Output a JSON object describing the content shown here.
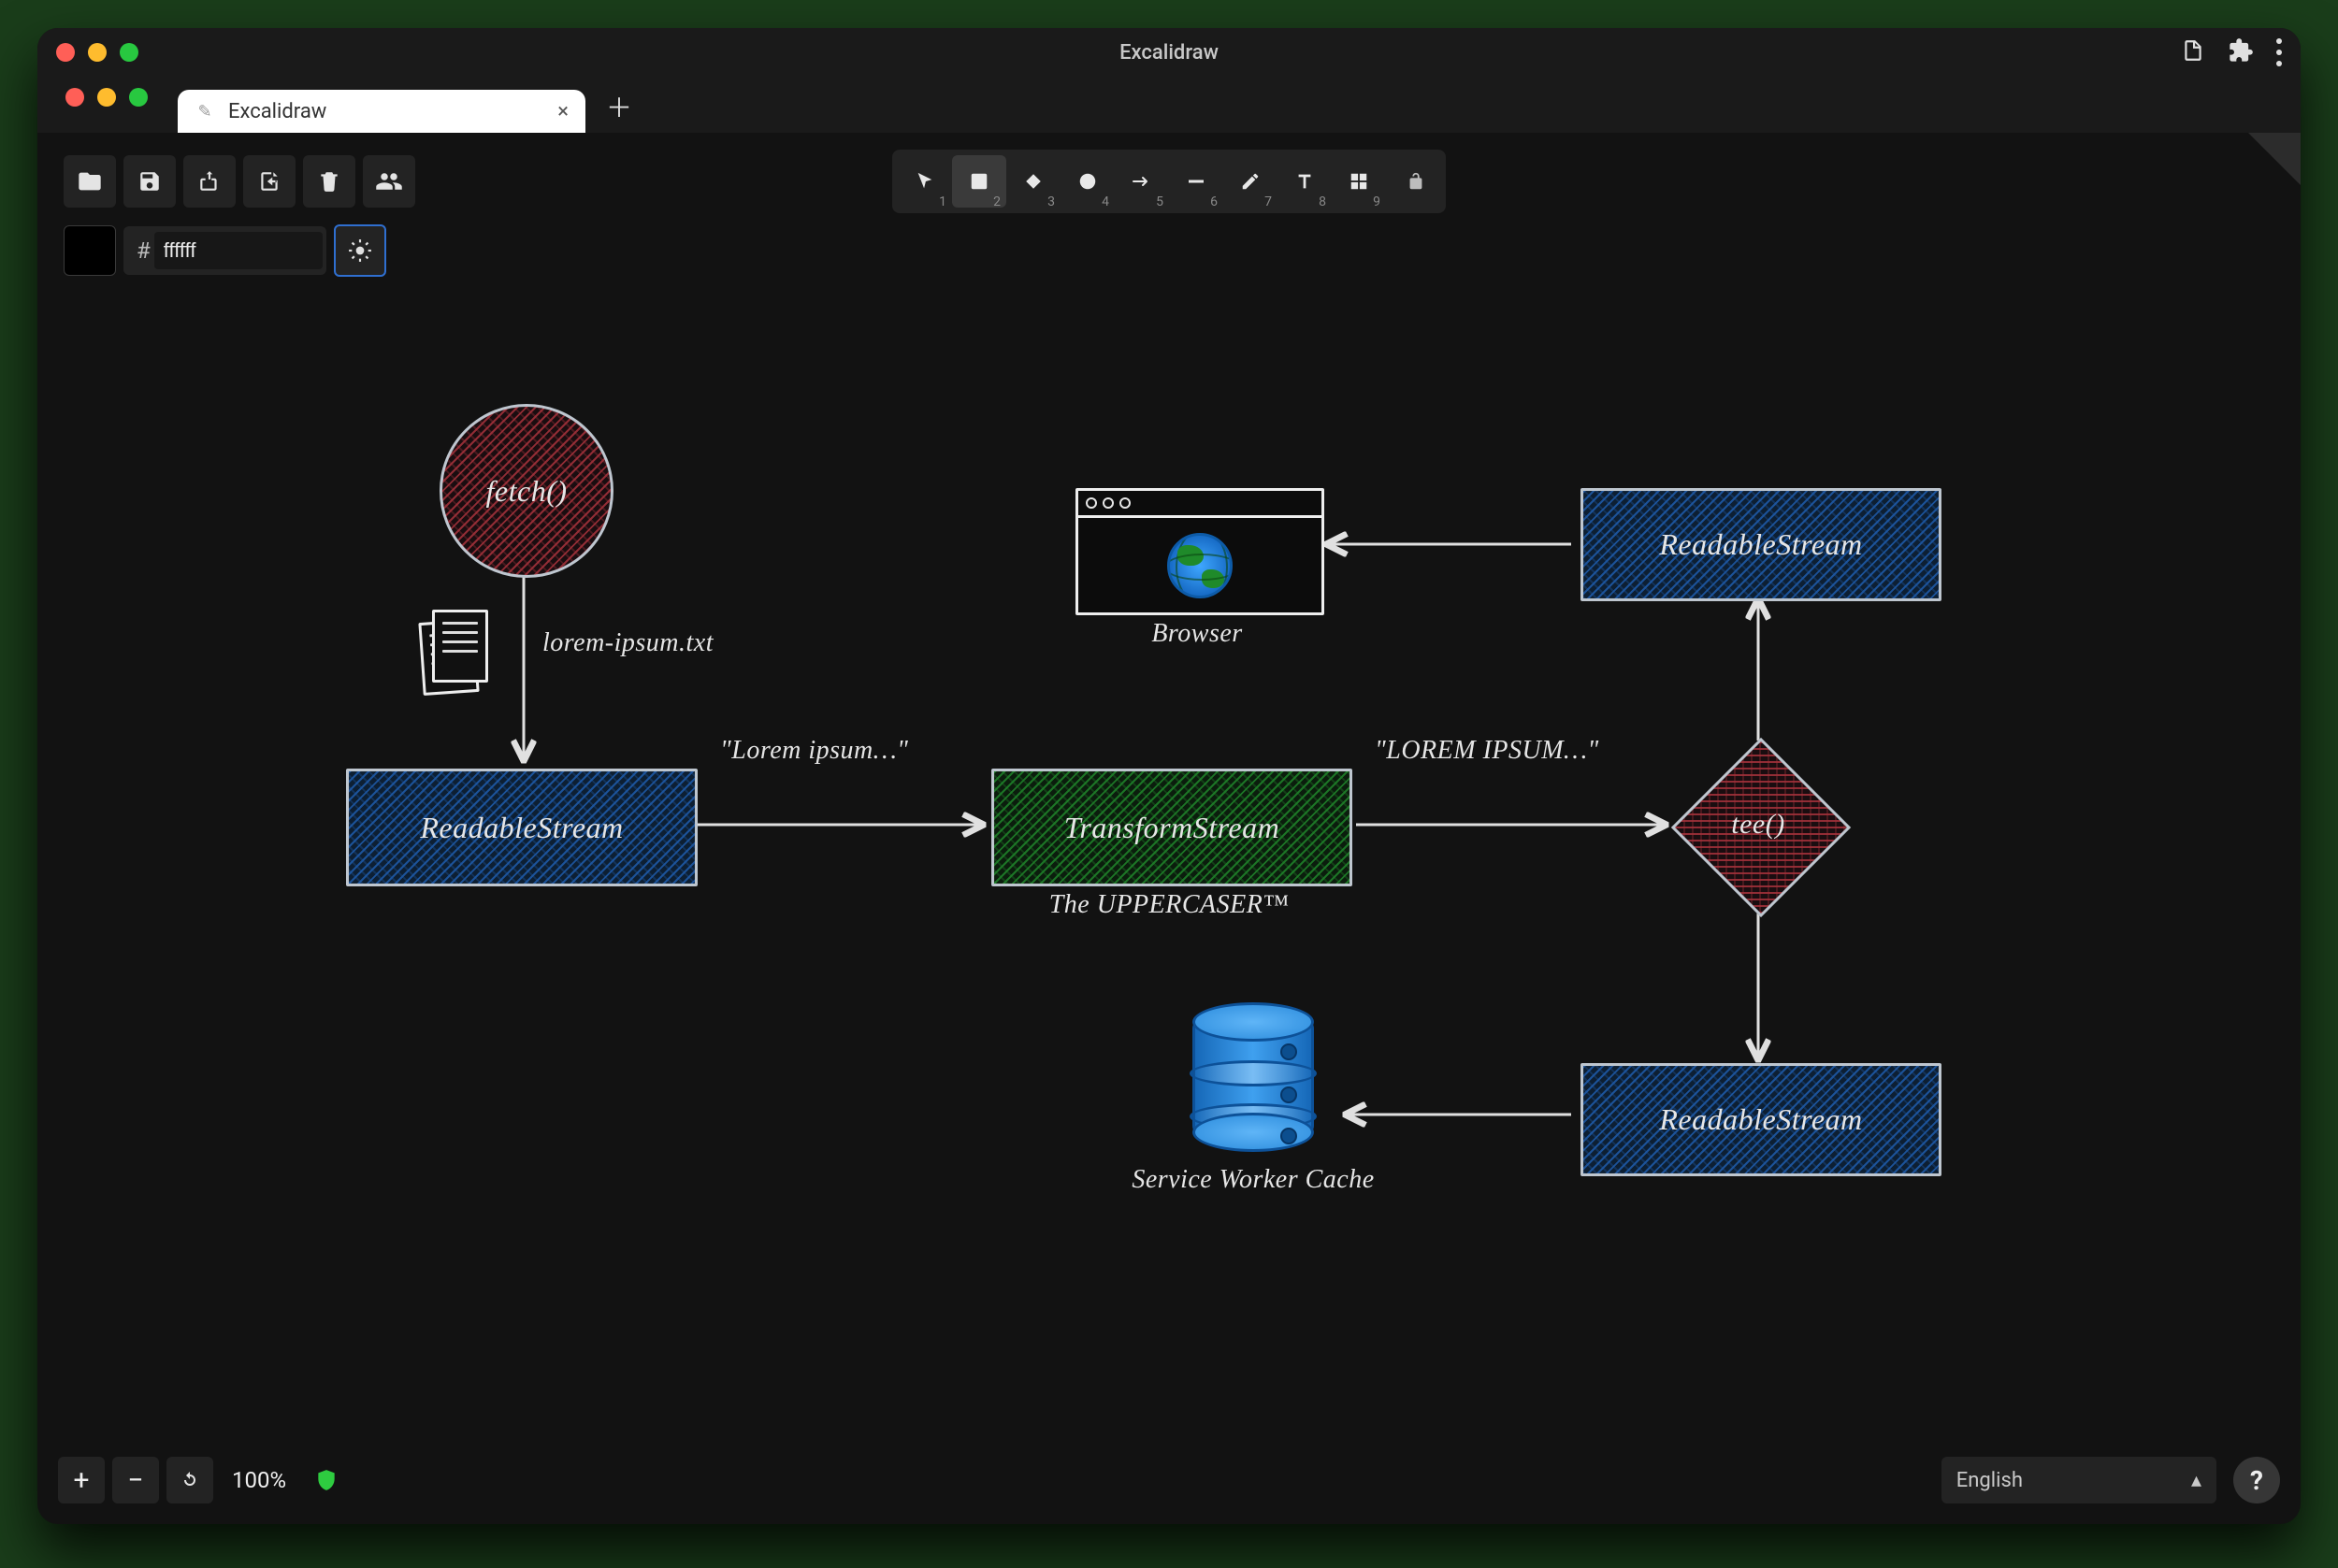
{
  "window": {
    "title": "Excalidraw"
  },
  "tab": {
    "label": "Excalidraw",
    "favicon_glyph": "✎"
  },
  "color": {
    "hex": "ffffff",
    "hash": "#"
  },
  "tools": {
    "n1": "1",
    "n2": "2",
    "n3": "3",
    "n4": "4",
    "n5": "5",
    "n6": "6",
    "n7": "7",
    "n8": "8",
    "n9": "9"
  },
  "zoom": {
    "label": "100%"
  },
  "language": {
    "value": "English"
  },
  "help_glyph": "?",
  "diagram": {
    "nodes": {
      "fetch": "fetch()",
      "readable1": "ReadableStream",
      "transform": "TransformStream",
      "transform_sub": "The UPPERCASER™",
      "tee": "tee()",
      "readable_top": "ReadableStream",
      "readable_bottom": "ReadableStream",
      "browser_label": "Browser",
      "sw_cache_label": "Service Worker Cache",
      "file_label": "lorem-ipsum.txt"
    },
    "edges": {
      "e1_label": "\"Lorem ipsum…\"",
      "e2_label": "\"LOREM IPSUM…\""
    }
  }
}
